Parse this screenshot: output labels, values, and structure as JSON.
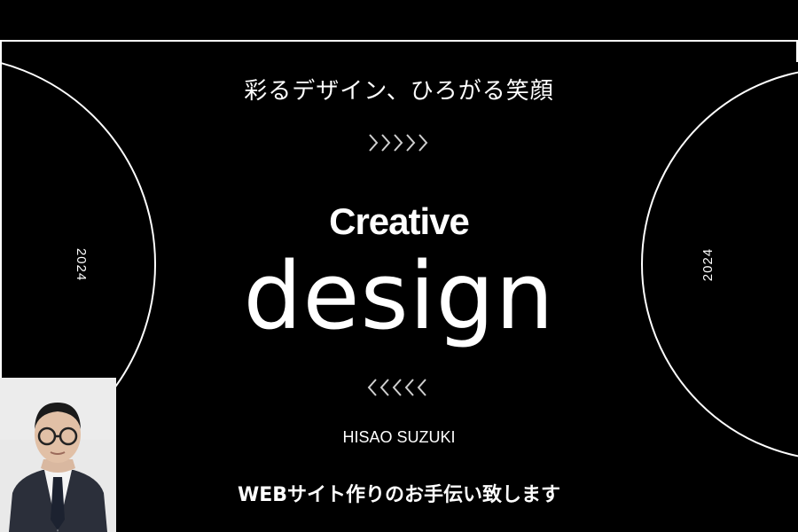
{
  "tagline": "彩るデザイン、ひろがる笑顔",
  "title_line1": "Creative",
  "title_line2": "design",
  "year_left": "2024",
  "year_right": "2024",
  "author": "HISAO SUZUKI",
  "service": "WEBサイト作りのお手伝い致します",
  "icons": {
    "top": "chevrons-right-icon",
    "bottom": "chevrons-left-icon"
  },
  "colors": {
    "background": "#000000",
    "foreground": "#ffffff",
    "photo_bg": "#e9e9e9",
    "suit": "#2b2f3a"
  }
}
